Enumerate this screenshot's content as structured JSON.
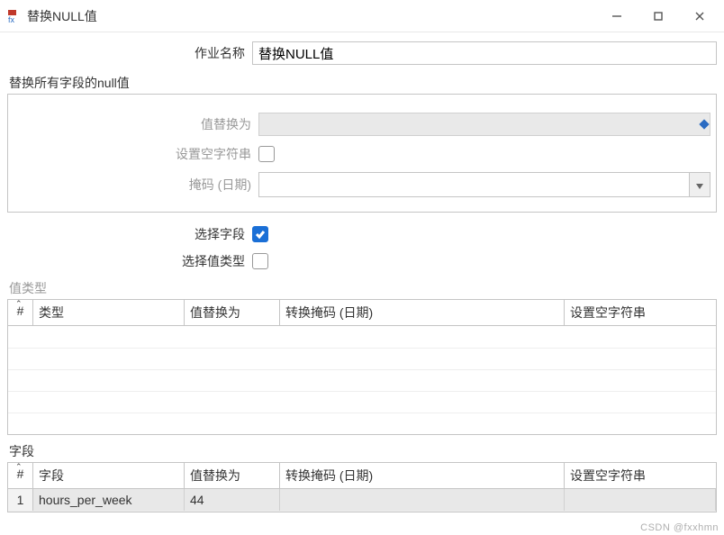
{
  "window": {
    "title": "替换NULL值"
  },
  "form": {
    "job_name_label": "作业名称",
    "job_name_value": "替换NULL值"
  },
  "group_all": {
    "title": "替换所有字段的null值",
    "replace_label": "值替换为",
    "empty_string_label": "设置空字符串",
    "empty_string_checked": false,
    "mask_label": "掩码 (日期)",
    "mask_value": ""
  },
  "group_select": {
    "select_field_label": "选择字段",
    "select_field_checked": true,
    "select_type_label": "选择值类型",
    "select_type_checked": false
  },
  "value_type_table": {
    "title": "值类型",
    "columns": {
      "idx": "#",
      "type": "类型",
      "replace": "值替换为",
      "mask": "转换掩码 (日期)",
      "empty": "设置空字符串"
    },
    "rows": []
  },
  "field_table": {
    "title": "字段",
    "columns": {
      "idx": "#",
      "field": "字段",
      "replace": "值替换为",
      "mask": "转换掩码 (日期)",
      "empty": "设置空字符串"
    },
    "rows": [
      {
        "idx": "1",
        "field": "hours_per_week",
        "replace": "44",
        "mask": "",
        "empty": ""
      }
    ]
  },
  "hash_glyph": "#",
  "watermark": "CSDN @fxxhmn"
}
